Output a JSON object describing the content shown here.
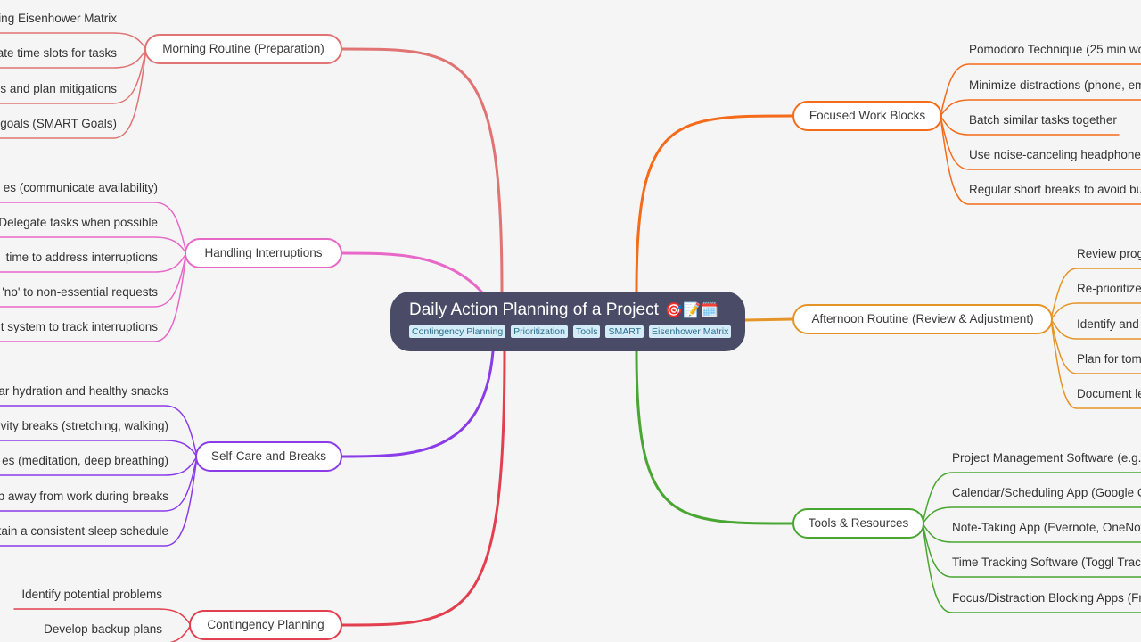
{
  "root": {
    "title": "Daily Action Planning of a Project",
    "emojis": [
      "target-icon",
      "memo-icon",
      "calendar-icon"
    ],
    "emoji_glyphs": "🎯📝🗓️",
    "tags": [
      "Contingency Planning",
      "Prioritization",
      "Tools",
      "SMART",
      "Eisenhower Matrix"
    ]
  },
  "branches": {
    "morning": {
      "label": "Morning Routine (Preparation)",
      "color": "#e07373",
      "children": [
        "ing Eisenhower Matrix",
        "ate time slots for tasks",
        "s and plan mitigations",
        "y goals (SMART Goals)"
      ]
    },
    "interruptions": {
      "label": "Handling Interruptions",
      "color": "#e868c8",
      "children": [
        "es (communicate availability)",
        "Delegate tasks when possible",
        "time to address interruptions",
        "'no' to non-essential requests",
        "t system to track interruptions"
      ]
    },
    "selfcare": {
      "label": "Self-Care and Breaks",
      "color": "#8a3ce8",
      "children": [
        "ar hydration and healthy snacks",
        "vity breaks (stretching, walking)",
        "es (meditation, deep breathing)",
        "p away from work during breaks",
        "tain a consistent sleep schedule"
      ]
    },
    "contingency": {
      "label": "Contingency Planning",
      "color": "#e2404f",
      "children": [
        "Identify potential problems",
        "Develop backup plans"
      ]
    },
    "focused": {
      "label": "Focused Work Blocks",
      "color": "#f56b1a",
      "children": [
        "Pomodoro Technique (25 min wo",
        "Minimize distractions (phone, em",
        "Batch similar tasks together",
        "Use noise-canceling headphones",
        "Regular short breaks to avoid bu"
      ]
    },
    "afternoon": {
      "label": "Afternoon Routine (Review & Adjustment)",
      "color": "#e59427",
      "children": [
        "Review prog",
        "Re-prioritize",
        "Identify and",
        "Plan for tom",
        "Document le"
      ]
    },
    "tools": {
      "label": "Tools & Resources",
      "color": "#4aa632",
      "children": [
        "Project Management Software (e.g.,",
        "Calendar/Scheduling App (Google C",
        "Note-Taking App (Evernote, OneNot",
        "Time Tracking Software (Toggl Track",
        "Focus/Distraction Blocking Apps (Fr"
      ]
    }
  }
}
